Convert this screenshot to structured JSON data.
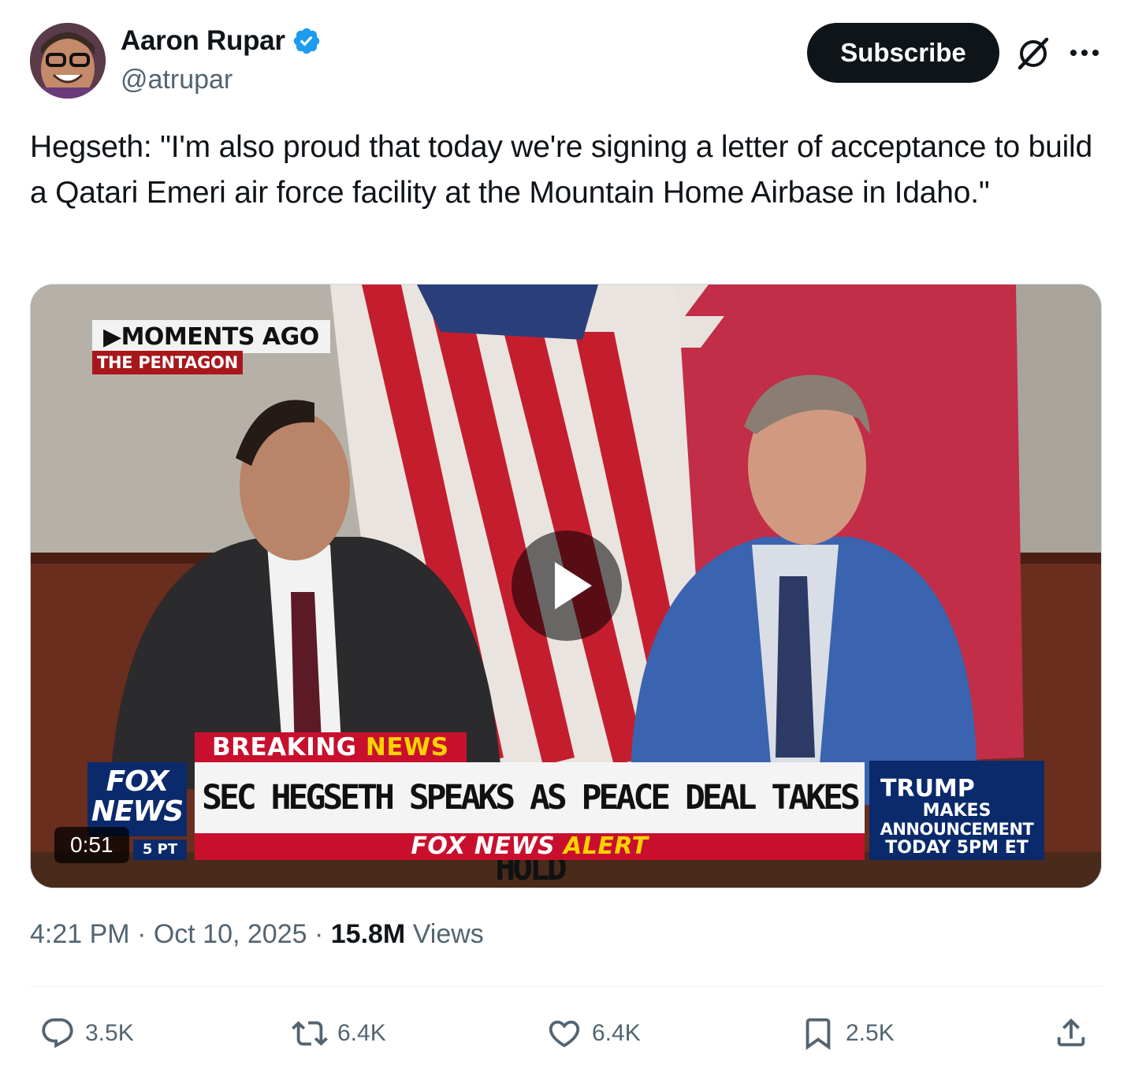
{
  "author": {
    "display_name": "Aaron Rupar",
    "handle": "@atrupar",
    "verified": true
  },
  "header": {
    "subscribe_label": "Subscribe",
    "grok_icon": "grok-icon",
    "more_icon": "more-icon"
  },
  "tweet": {
    "text": "Hegseth: \"I'm also proud that today we're signing a letter of acceptance to build a Qatari Emeri air force facility at the Mountain Home Airbase in Idaho.\""
  },
  "video": {
    "duration": "0:51",
    "overlay": {
      "moments_ago": "▶MOMENTS AGO",
      "location": "THE PENTAGON",
      "breaking_a": "BREAKING ",
      "breaking_b": "NEWS",
      "headline": "SEC HEGSETH SPEAKS AS PEACE DEAL TAKES HOLD",
      "alert_a": "FOX NEWS ",
      "alert_b": "ALERT",
      "fox_logo_1": "FOX",
      "fox_logo_2": "NEWS",
      "fox_time": "5 PT",
      "trump_1": "TRUMP",
      "trump_2": "MAKES",
      "trump_3": "ANNOUNCEMENT",
      "trump_4": "TODAY 5PM ET"
    }
  },
  "meta": {
    "time": "4:21 PM",
    "date": "Oct 10, 2025",
    "views_count": "15.8M",
    "views_label": "Views"
  },
  "actions": {
    "replies": "3.5K",
    "reposts": "6.4K",
    "likes": "6.4K",
    "bookmarks": "2.5K"
  },
  "colors": {
    "text_primary": "#0f1419",
    "text_secondary": "#536471",
    "verified_blue": "#1d9bf0",
    "subscribe_bg": "#0f1419"
  }
}
